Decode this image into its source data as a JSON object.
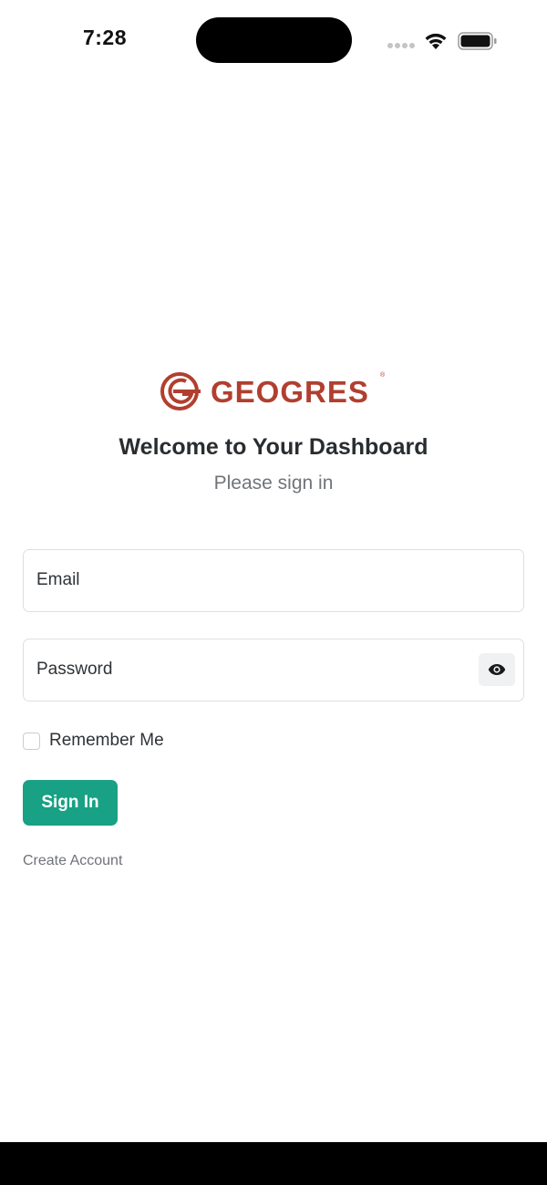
{
  "status_bar": {
    "time": "7:28",
    "icons": [
      "signal-icon",
      "wifi-icon",
      "battery-icon"
    ]
  },
  "brand": {
    "name": "GEOGRES",
    "registered_mark": "®",
    "color": "#b13f2f"
  },
  "header": {
    "title": "Welcome to Your Dashboard",
    "subtitle": "Please sign in"
  },
  "form": {
    "email": {
      "placeholder": "Email",
      "value": ""
    },
    "password": {
      "placeholder": "Password",
      "value": "",
      "toggle_icon": "eye-icon"
    },
    "remember_me": {
      "label": "Remember Me",
      "checked": false
    },
    "submit_label": "Sign In",
    "create_account_label": "Create Account"
  },
  "colors": {
    "primary": "#18a184",
    "text": "#2a2d30",
    "muted": "#707479",
    "border": "#dcdfe2"
  }
}
